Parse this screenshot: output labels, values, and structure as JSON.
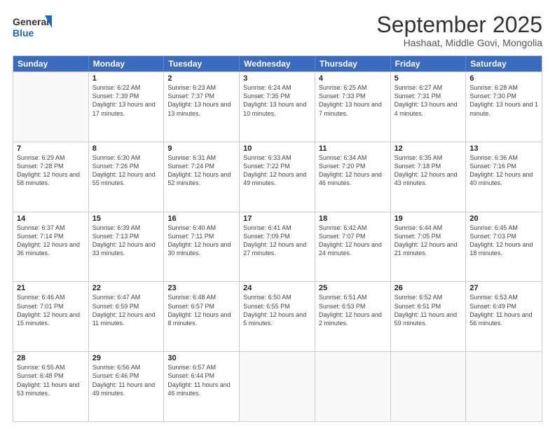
{
  "logo": {
    "general": "General",
    "blue": "Blue"
  },
  "header": {
    "month": "September 2025",
    "location": "Hashaat, Middle Govi, Mongolia"
  },
  "weekdays": [
    "Sunday",
    "Monday",
    "Tuesday",
    "Wednesday",
    "Thursday",
    "Friday",
    "Saturday"
  ],
  "weeks": [
    [
      {
        "day": "",
        "sunrise": "",
        "sunset": "",
        "daylight": ""
      },
      {
        "day": "1",
        "sunrise": "Sunrise: 6:22 AM",
        "sunset": "Sunset: 7:39 PM",
        "daylight": "Daylight: 13 hours and 17 minutes."
      },
      {
        "day": "2",
        "sunrise": "Sunrise: 6:23 AM",
        "sunset": "Sunset: 7:37 PM",
        "daylight": "Daylight: 13 hours and 13 minutes."
      },
      {
        "day": "3",
        "sunrise": "Sunrise: 6:24 AM",
        "sunset": "Sunset: 7:35 PM",
        "daylight": "Daylight: 13 hours and 10 minutes."
      },
      {
        "day": "4",
        "sunrise": "Sunrise: 6:25 AM",
        "sunset": "Sunset: 7:33 PM",
        "daylight": "Daylight: 13 hours and 7 minutes."
      },
      {
        "day": "5",
        "sunrise": "Sunrise: 6:27 AM",
        "sunset": "Sunset: 7:31 PM",
        "daylight": "Daylight: 13 hours and 4 minutes."
      },
      {
        "day": "6",
        "sunrise": "Sunrise: 6:28 AM",
        "sunset": "Sunset: 7:30 PM",
        "daylight": "Daylight: 13 hours and 1 minute."
      }
    ],
    [
      {
        "day": "7",
        "sunrise": "Sunrise: 6:29 AM",
        "sunset": "Sunset: 7:28 PM",
        "daylight": "Daylight: 12 hours and 58 minutes."
      },
      {
        "day": "8",
        "sunrise": "Sunrise: 6:30 AM",
        "sunset": "Sunset: 7:26 PM",
        "daylight": "Daylight: 12 hours and 55 minutes."
      },
      {
        "day": "9",
        "sunrise": "Sunrise: 6:31 AM",
        "sunset": "Sunset: 7:24 PM",
        "daylight": "Daylight: 12 hours and 52 minutes."
      },
      {
        "day": "10",
        "sunrise": "Sunrise: 6:33 AM",
        "sunset": "Sunset: 7:22 PM",
        "daylight": "Daylight: 12 hours and 49 minutes."
      },
      {
        "day": "11",
        "sunrise": "Sunrise: 6:34 AM",
        "sunset": "Sunset: 7:20 PM",
        "daylight": "Daylight: 12 hours and 46 minutes."
      },
      {
        "day": "12",
        "sunrise": "Sunrise: 6:35 AM",
        "sunset": "Sunset: 7:18 PM",
        "daylight": "Daylight: 12 hours and 43 minutes."
      },
      {
        "day": "13",
        "sunrise": "Sunrise: 6:36 AM",
        "sunset": "Sunset: 7:16 PM",
        "daylight": "Daylight: 12 hours and 40 minutes."
      }
    ],
    [
      {
        "day": "14",
        "sunrise": "Sunrise: 6:37 AM",
        "sunset": "Sunset: 7:14 PM",
        "daylight": "Daylight: 12 hours and 36 minutes."
      },
      {
        "day": "15",
        "sunrise": "Sunrise: 6:39 AM",
        "sunset": "Sunset: 7:13 PM",
        "daylight": "Daylight: 12 hours and 33 minutes."
      },
      {
        "day": "16",
        "sunrise": "Sunrise: 6:40 AM",
        "sunset": "Sunset: 7:11 PM",
        "daylight": "Daylight: 12 hours and 30 minutes."
      },
      {
        "day": "17",
        "sunrise": "Sunrise: 6:41 AM",
        "sunset": "Sunset: 7:09 PM",
        "daylight": "Daylight: 12 hours and 27 minutes."
      },
      {
        "day": "18",
        "sunrise": "Sunrise: 6:42 AM",
        "sunset": "Sunset: 7:07 PM",
        "daylight": "Daylight: 12 hours and 24 minutes."
      },
      {
        "day": "19",
        "sunrise": "Sunrise: 6:44 AM",
        "sunset": "Sunset: 7:05 PM",
        "daylight": "Daylight: 12 hours and 21 minutes."
      },
      {
        "day": "20",
        "sunrise": "Sunrise: 6:45 AM",
        "sunset": "Sunset: 7:03 PM",
        "daylight": "Daylight: 12 hours and 18 minutes."
      }
    ],
    [
      {
        "day": "21",
        "sunrise": "Sunrise: 6:46 AM",
        "sunset": "Sunset: 7:01 PM",
        "daylight": "Daylight: 12 hours and 15 minutes."
      },
      {
        "day": "22",
        "sunrise": "Sunrise: 6:47 AM",
        "sunset": "Sunset: 6:59 PM",
        "daylight": "Daylight: 12 hours and 11 minutes."
      },
      {
        "day": "23",
        "sunrise": "Sunrise: 6:48 AM",
        "sunset": "Sunset: 6:57 PM",
        "daylight": "Daylight: 12 hours and 8 minutes."
      },
      {
        "day": "24",
        "sunrise": "Sunrise: 6:50 AM",
        "sunset": "Sunset: 6:55 PM",
        "daylight": "Daylight: 12 hours and 5 minutes."
      },
      {
        "day": "25",
        "sunrise": "Sunrise: 6:51 AM",
        "sunset": "Sunset: 6:53 PM",
        "daylight": "Daylight: 12 hours and 2 minutes."
      },
      {
        "day": "26",
        "sunrise": "Sunrise: 6:52 AM",
        "sunset": "Sunset: 6:51 PM",
        "daylight": "Daylight: 11 hours and 59 minutes."
      },
      {
        "day": "27",
        "sunrise": "Sunrise: 6:53 AM",
        "sunset": "Sunset: 6:49 PM",
        "daylight": "Daylight: 11 hours and 56 minutes."
      }
    ],
    [
      {
        "day": "28",
        "sunrise": "Sunrise: 6:55 AM",
        "sunset": "Sunset: 6:48 PM",
        "daylight": "Daylight: 11 hours and 53 minutes."
      },
      {
        "day": "29",
        "sunrise": "Sunrise: 6:56 AM",
        "sunset": "Sunset: 6:46 PM",
        "daylight": "Daylight: 11 hours and 49 minutes."
      },
      {
        "day": "30",
        "sunrise": "Sunrise: 6:57 AM",
        "sunset": "Sunset: 6:44 PM",
        "daylight": "Daylight: 11 hours and 46 minutes."
      },
      {
        "day": "",
        "sunrise": "",
        "sunset": "",
        "daylight": ""
      },
      {
        "day": "",
        "sunrise": "",
        "sunset": "",
        "daylight": ""
      },
      {
        "day": "",
        "sunrise": "",
        "sunset": "",
        "daylight": ""
      },
      {
        "day": "",
        "sunrise": "",
        "sunset": "",
        "daylight": ""
      }
    ]
  ]
}
